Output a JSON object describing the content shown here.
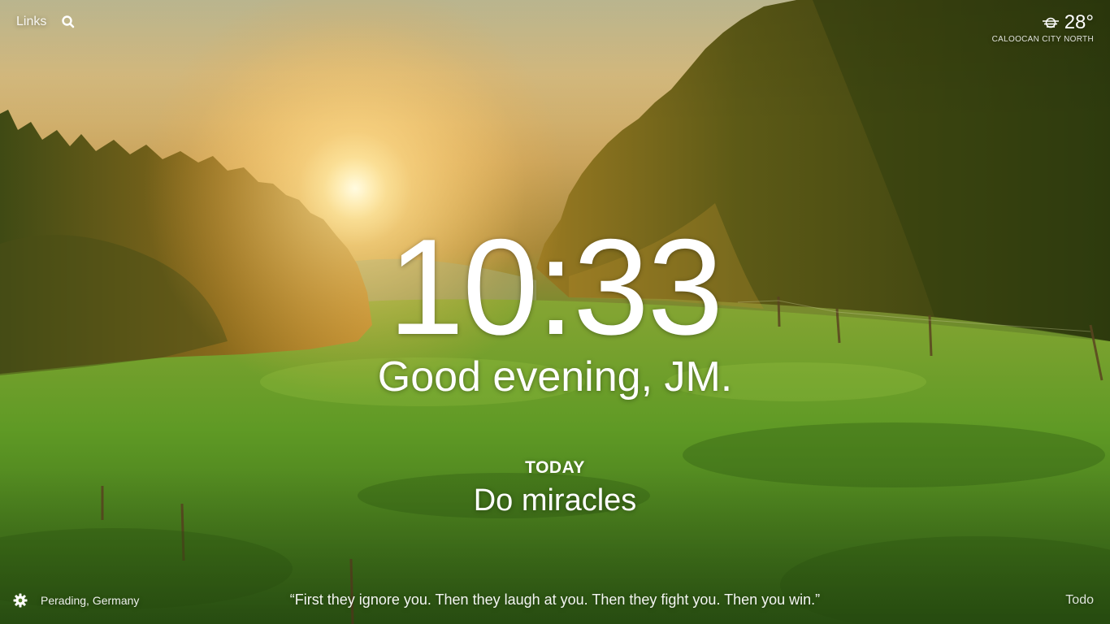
{
  "top_bar": {
    "links_label": "Links",
    "search_icon": "search-icon"
  },
  "weather": {
    "icon": "haze-icon",
    "temperature": "28°",
    "location": "CALOOCAN CITY NORTH"
  },
  "clock": {
    "time": "10:33"
  },
  "greeting": {
    "text": "Good evening, JM."
  },
  "focus": {
    "heading": "TODAY",
    "text": "Do miracles"
  },
  "footer": {
    "settings_icon": "gear-icon",
    "photo_location": "Perading, Germany",
    "quote": "“First they ignore you. Then they laugh at you. Then they fight you. Then you win.”",
    "todo_label": "Todo"
  }
}
